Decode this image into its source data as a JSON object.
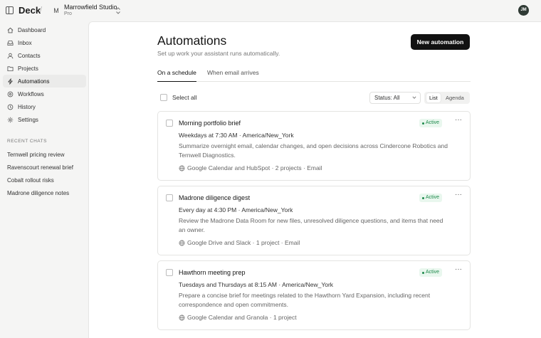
{
  "app": {
    "name": "Deck",
    "separator": "/"
  },
  "workspace": {
    "initial": "M",
    "name": "Marrowfield Studio",
    "plan": "Pro"
  },
  "user": {
    "initials": "JM"
  },
  "sidebar": {
    "items": [
      {
        "label": "Dashboard",
        "icon": "home-icon"
      },
      {
        "label": "Inbox",
        "icon": "inbox-icon"
      },
      {
        "label": "Contacts",
        "icon": "user-icon"
      },
      {
        "label": "Projects",
        "icon": "folder-icon"
      },
      {
        "label": "Automations",
        "icon": "bolt-icon",
        "active": true
      },
      {
        "label": "Workflows",
        "icon": "workflow-icon"
      },
      {
        "label": "History",
        "icon": "history-icon"
      },
      {
        "label": "Settings",
        "icon": "gear-icon"
      }
    ],
    "recent_heading": "RECENT CHATS",
    "recent": [
      "Ternwell pricing review",
      "Ravenscourt renewal brief",
      "Cobalt rollout risks",
      "Madrone diligence notes"
    ]
  },
  "page": {
    "title": "Automations",
    "subtitle": "Set up work your assistant runs automatically.",
    "new_button": "New automation",
    "tabs": [
      {
        "label": "On a schedule",
        "active": true
      },
      {
        "label": "When email arrives"
      }
    ]
  },
  "toolbar": {
    "select_all": "Select all",
    "status_filter": "Status: All",
    "views": [
      "List",
      "Agenda"
    ],
    "active_view": "List"
  },
  "automations": [
    {
      "title": "Morning portfolio brief",
      "schedule": "Weekdays at 7:30 AM",
      "timezone": "America/New_York",
      "description": "Summarize overnight email, calendar changes, and open decisions across Cindercone Robotics and Ternwell Diagnostics.",
      "meta": "Google Calendar and HubSpot · 2 projects · Email",
      "status": "Active"
    },
    {
      "title": "Madrone diligence digest",
      "schedule": "Every day at 4:30 PM",
      "timezone": "America/New_York",
      "description": "Review the Madrone Data Room for new files, unresolved diligence questions, and items that need an owner.",
      "meta": "Google Drive and Slack · 1 project · Email",
      "status": "Active"
    },
    {
      "title": "Hawthorn meeting prep",
      "schedule": "Tuesdays and Thursdays at 8:15 AM",
      "timezone": "America/New_York",
      "description": "Prepare a concise brief for meetings related to the Hawthorn Yard Expansion, including recent correspondence and open commitments.",
      "meta": "Google Calendar and Granola · 1 project",
      "status": "Active"
    }
  ],
  "colors": {
    "accent": "#111111",
    "active_badge_bg": "#e9f7ee",
    "active_badge_text": "#1e8a4c"
  }
}
